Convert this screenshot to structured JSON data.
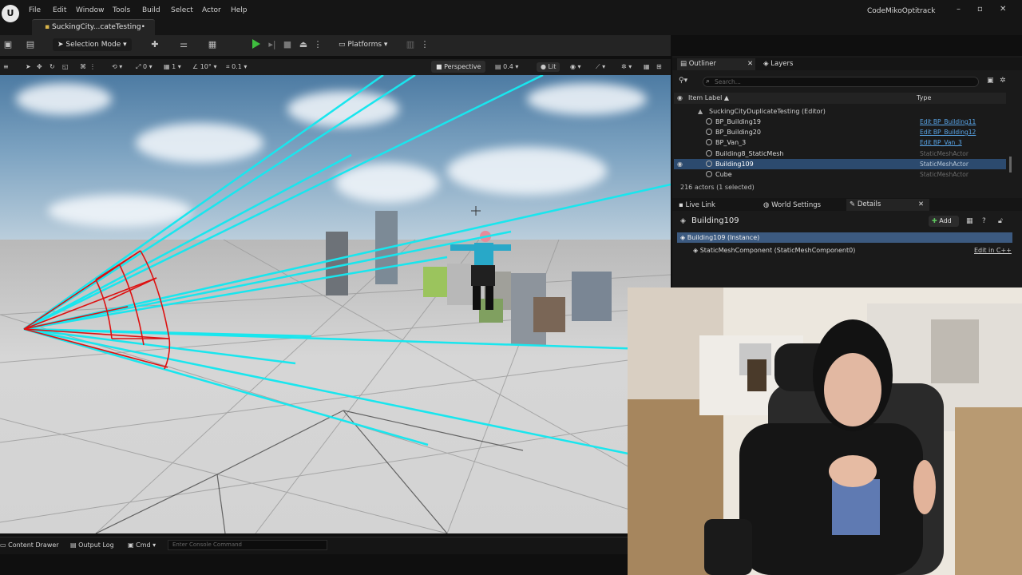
{
  "titlebar": {
    "logo": "unreal-logo",
    "menu": [
      "File",
      "Edit",
      "Window",
      "Tools",
      "Build",
      "Select",
      "Actor",
      "Help"
    ],
    "document_tab": "SuckingCity...cateTesting•",
    "project": "CodeMikoOptitrack"
  },
  "toolbar": {
    "mode": "Selection Mode",
    "platforms": "Platforms"
  },
  "viewport_toolbar": {
    "rot_snap": "0",
    "scale_snap": "1",
    "angle_snap": "10°",
    "scale_value": "0.1",
    "view_mode": "Perspective",
    "camera_speed": "0.4",
    "lighting": "Lit"
  },
  "statusbar": {
    "content_drawer": "Content Drawer",
    "output_log": "Output Log",
    "cmd": "Cmd",
    "console_placeholder": "Enter Console Command"
  },
  "outliner": {
    "tab_outliner": "Outliner",
    "tab_layers": "Layers",
    "search_placeholder": "Search...",
    "col_label": "Item Label ▲",
    "col_type": "Type",
    "rows": [
      {
        "label": "SuckingCityDuplicateTesting (Editor)",
        "type": "",
        "link": false
      },
      {
        "label": "BP_Building19",
        "type": "Edit BP_Building11",
        "link": true
      },
      {
        "label": "BP_Building20",
        "type": "Edit BP_Building12",
        "link": true
      },
      {
        "label": "BP_Van_3",
        "type": "Edit BP_Van_3",
        "link": true
      },
      {
        "label": "Building8_StaticMesh",
        "type": "StaticMeshActor",
        "link": false
      },
      {
        "label": "Building109",
        "type": "StaticMeshActor",
        "link": false
      },
      {
        "label": "Cube",
        "type": "StaticMeshActor",
        "link": false
      }
    ],
    "actor_count": "216 actors (1 selected)"
  },
  "details": {
    "tab_livelink": "Live Link",
    "tab_world": "World Settings",
    "tab_details": "Details",
    "title": "Building109",
    "add_label": "Add",
    "instance": "Building109 (Instance)",
    "component": "StaticMeshComponent (StaticMeshComponent0)",
    "edit_cpp": "Edit in C++"
  },
  "colors": {
    "accent_blue": "#2c4a6e",
    "link_blue": "#59a6e9",
    "play_green": "#3fbe3f",
    "ray_cyan": "#19e6ee",
    "frustum_red": "#dd1111"
  }
}
